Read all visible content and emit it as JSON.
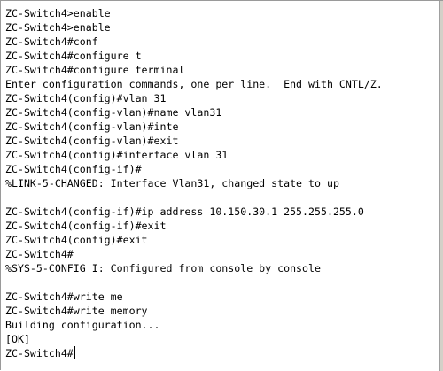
{
  "terminal": {
    "lines": [
      "ZC-Switch4>enable",
      "ZC-Switch4>enable",
      "ZC-Switch4#conf",
      "ZC-Switch4#configure t",
      "ZC-Switch4#configure terminal",
      "Enter configuration commands, one per line.  End with CNTL/Z.",
      "ZC-Switch4(config)#vlan 31",
      "ZC-Switch4(config-vlan)#name vlan31",
      "ZC-Switch4(config-vlan)#inte",
      "ZC-Switch4(config-vlan)#exit",
      "ZC-Switch4(config)#interface vlan 31",
      "ZC-Switch4(config-if)#",
      "%LINK-5-CHANGED: Interface Vlan31, changed state to up",
      "",
      "ZC-Switch4(config-if)#ip address 10.150.30.1 255.255.255.0",
      "ZC-Switch4(config-if)#exit",
      "ZC-Switch4(config)#exit",
      "ZC-Switch4#",
      "%SYS-5-CONFIG_I: Configured from console by console",
      "",
      "ZC-Switch4#write me",
      "ZC-Switch4#write memory",
      "Building configuration...",
      "[OK]"
    ],
    "prompt": "ZC-Switch4#"
  }
}
